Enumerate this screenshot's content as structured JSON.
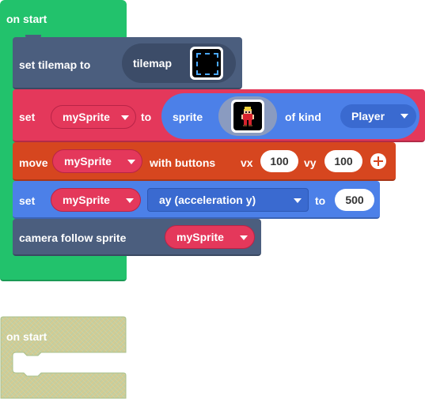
{
  "colors": {
    "event_green": "#22c26c",
    "scene_blue": "#4b5e7e",
    "sprites_red": "#e4385b",
    "controller_orange": "#d6461f",
    "sprite_blue": "#4c80e8",
    "disabled_yellow": "#d3cb92"
  },
  "workspace": {
    "on_start_hat": {
      "label": "on start"
    },
    "set_tilemap": {
      "label": "set tilemap to",
      "arg": {
        "label": "tilemap",
        "icon": "tilemap-preview-icon"
      }
    },
    "set_sprite": {
      "label": "set",
      "variable": "mySprite",
      "to": "to",
      "sprite_reporter": {
        "label": "sprite",
        "icon": "character-sprite-icon",
        "of_kind": "of kind",
        "kind": "Player"
      }
    },
    "move_with_buttons": {
      "label": "move",
      "variable": "mySprite",
      "with_buttons": "with buttons",
      "vx_label": "vx",
      "vx": "100",
      "vy_label": "vy",
      "vy": "100",
      "expand_icon": "plus-circle-icon"
    },
    "set_acceleration": {
      "label": "set",
      "variable": "mySprite",
      "property": "ay (acceleration y)",
      "to": "to",
      "value": "500"
    },
    "camera_follow": {
      "label": "camera follow sprite",
      "variable": "mySprite"
    },
    "disabled_on_start": {
      "label": "on start"
    }
  }
}
